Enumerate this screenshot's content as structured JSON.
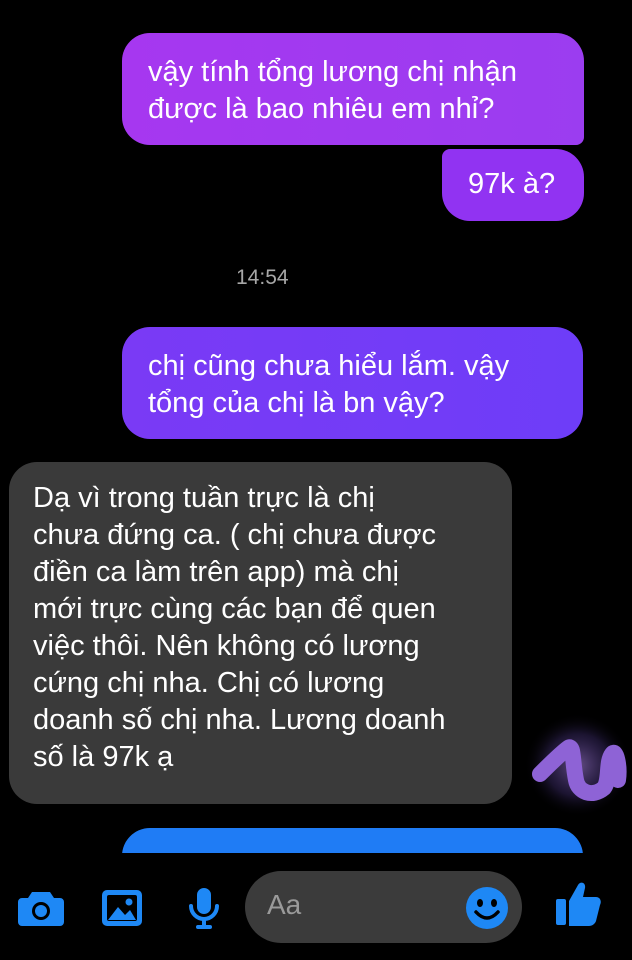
{
  "conversation": {
    "messages": [
      {
        "sender": "me",
        "text": "vậy tính tổng lương chị nhận\nđược là bao nhiêu em nhỉ?"
      },
      {
        "sender": "me",
        "text": "97k à?"
      },
      {
        "sender": "me",
        "text": "chị cũng chưa hiểu lắm.  vậy\ntổng của chị là bn vậy?"
      },
      {
        "sender": "them",
        "text": "Dạ vì trong tuần trực là chị\nchưa đứng ca. ( chị chưa được\nđiền ca làm trên app) mà chị\nmới trực cùng các bạn để quen\nviệc thôi. Nên không có lương\ncứng chị nha. Chị có lương\ndoanh số chị nha. Lương doanh\nsố là 97k ạ"
      }
    ],
    "timestamp": "14:54"
  },
  "composer": {
    "placeholder": "Aa",
    "icons": [
      "camera-icon",
      "image-icon",
      "microphone-icon",
      "emoji-icon",
      "thumbs-up-icon"
    ]
  },
  "colors": {
    "outgoing_top": "#a637f0",
    "outgoing_mid": "#7a3af5",
    "outgoing_bottom": "#1f7cf5",
    "incoming": "#3a3a3a",
    "accent_icon": "#1e88f5"
  }
}
